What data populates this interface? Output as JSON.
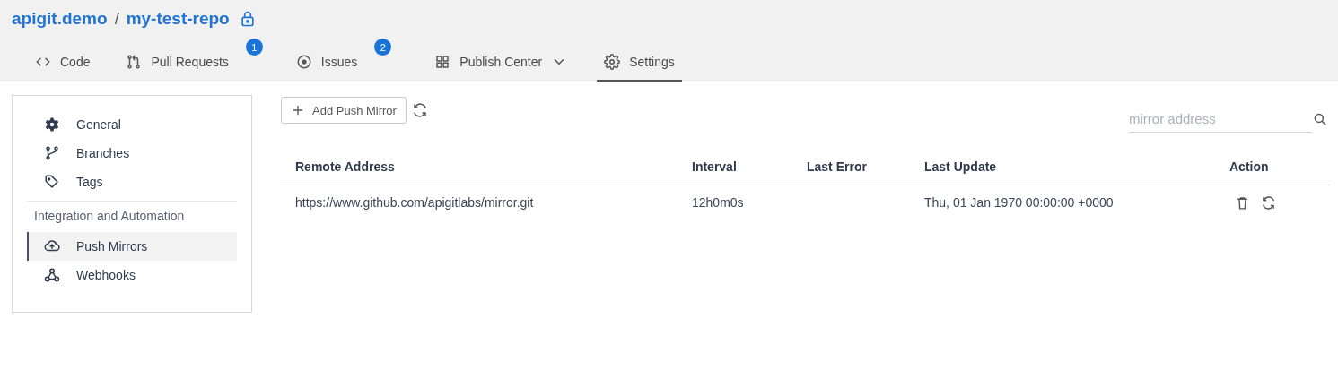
{
  "breadcrumb": {
    "owner": "apigit.demo",
    "separator": "/",
    "repo": "my-test-repo",
    "locked": true
  },
  "tabs": [
    {
      "label": "Code",
      "selected": false
    },
    {
      "label": "Pull Requests",
      "badge": "1",
      "selected": false
    },
    {
      "label": "Issues",
      "badge": "2",
      "selected": false
    },
    {
      "label": "Publish Center",
      "dropdown": true,
      "selected": false
    },
    {
      "label": "Settings",
      "selected": true
    }
  ],
  "sidebar": {
    "groups": [
      {
        "items": [
          {
            "label": "General",
            "selected": false
          },
          {
            "label": "Branches",
            "selected": false
          },
          {
            "label": "Tags",
            "selected": false
          }
        ]
      },
      {
        "heading": "Integration and Automation",
        "items": [
          {
            "label": "Push Mirrors",
            "selected": true
          },
          {
            "label": "Webhooks",
            "selected": false
          }
        ]
      }
    ]
  },
  "toolbar": {
    "add_button": "Add Push Mirror",
    "search": {
      "placeholder": "mirror address"
    }
  },
  "table": {
    "columns": [
      "Remote Address",
      "Interval",
      "Last Error",
      "Last Update",
      "Action"
    ],
    "rows": [
      {
        "remote_address": "https://www.github.com/apigitlabs/mirror.git",
        "interval": "12h0m0s",
        "last_error": "",
        "last_update": "Thu, 01 Jan 1970 00:00:00 +0000"
      }
    ]
  }
}
